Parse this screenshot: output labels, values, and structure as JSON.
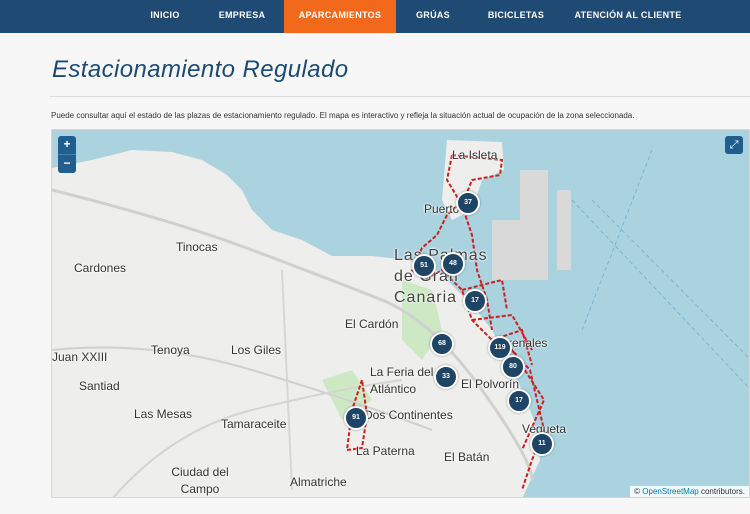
{
  "nav": {
    "items": [
      {
        "label": "INICIO"
      },
      {
        "label": "EMPRESA"
      },
      {
        "label": "APARCAMIENTOS"
      },
      {
        "label": "GRÚAS"
      },
      {
        "label": "BICICLETAS"
      },
      {
        "label": "ATENCIÓN AL CLIENTE"
      }
    ],
    "active": "APARCAMIENTOS",
    "colors": {
      "bar": "#1f4a73",
      "active": "#f2691b"
    }
  },
  "page": {
    "title": "Estacionamiento Regulado",
    "description": "Puede consultar aquí el estado de las plazas de estacionamiento regulado. El mapa es interactivo y refleja la situación actual de ocupación de la zona seleccionada."
  },
  "map": {
    "zoom_in": "+",
    "zoom_out": "−",
    "fullscreen_icon": "expand-icon",
    "places": [
      "La Isleta",
      "Puerto",
      "Tinocas",
      "Cardones",
      "Las Palmas de Gran Canaria",
      "El Cardón",
      "Tenoya",
      "Los Giles",
      "Juan XXIII",
      "Santiad",
      "Las Mesas",
      "La Feria del Atlántico",
      "Tamaraceite",
      "Dos Continentes",
      "Arenales",
      "El Polvorín",
      "Vegueta",
      "La Paterna",
      "Ciudad del Campo",
      "El Batán",
      "Almatriche"
    ],
    "markers": [
      "37",
      "51",
      "48",
      "17",
      "68",
      "119",
      "80",
      "33",
      "17",
      "91",
      "11"
    ],
    "attribution": {
      "prefix": "© ",
      "link": "OpenStreetMap",
      "suffix": " contributors."
    },
    "colors": {
      "sea": "#aad3df",
      "land": "#eeeeec",
      "zones": "#cc1f1f",
      "marker": "#1e4566"
    }
  }
}
